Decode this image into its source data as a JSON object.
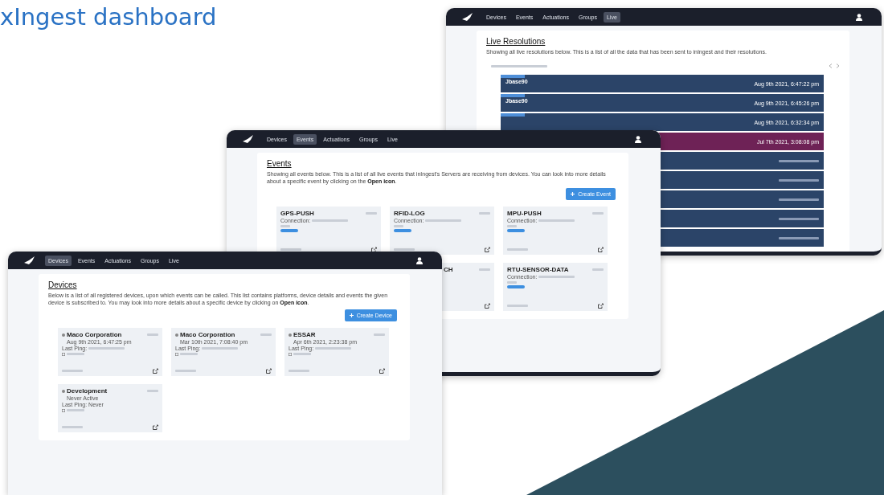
{
  "title": "xIngest dashboard",
  "windows": [
    {
      "kind": "live",
      "nav": [
        {
          "label": "Devices",
          "selected": false
        },
        {
          "label": "Events",
          "selected": false
        },
        {
          "label": "Actuations",
          "selected": false
        },
        {
          "label": "Groups",
          "selected": false
        },
        {
          "label": "Live",
          "selected": true
        }
      ],
      "heading": "Live Resolutions",
      "description": "Showing all live resolutions below. This is a list of all the data that has been sent to inIngest and their resolutions.",
      "rows": [
        {
          "name": "Jbase90",
          "time": "Aug 9th 2021, 6:47:22 pm",
          "color": "#2b4468"
        },
        {
          "name": "Jbase90",
          "time": "Aug 9th 2021, 6:45:26 pm",
          "color": "#2b4468"
        },
        {
          "time": "Aug 9th 2021, 6:32:34 pm",
          "color": "#2b4468"
        },
        {
          "time": "Jul 7th 2021, 3:08:08 pm",
          "color": "#6e2256"
        },
        {
          "color": "#2b4468"
        },
        {
          "color": "#2b4468"
        },
        {
          "color": "#2b4468"
        },
        {
          "color": "#2b4468"
        },
        {
          "color": "#2b4468"
        }
      ]
    },
    {
      "kind": "events",
      "nav": [
        {
          "label": "Devices",
          "selected": false
        },
        {
          "label": "Events",
          "selected": true
        },
        {
          "label": "Actuations",
          "selected": false
        },
        {
          "label": "Groups",
          "selected": false
        },
        {
          "label": "Live",
          "selected": false
        }
      ],
      "heading": "Events",
      "description": "Showing all events below. This is a list of all live events that inIngest's Servers are receiving from devices. You can look into more details about a specific event by clicking on the **Open icon**.",
      "button": "Create Event",
      "cards": [
        {
          "name": "GPS-PUSH",
          "label": "Connection:"
        },
        {
          "name": "RFID-LOG",
          "label": "Connection:"
        },
        {
          "name": "MPU-PUSH",
          "label": "Connection:"
        },
        {
          "name": "CH"
        },
        {
          "name": "RTU-SENSOR-DATA",
          "label": "Connection:"
        }
      ]
    },
    {
      "kind": "devices",
      "nav": [
        {
          "label": "Devices",
          "selected": true
        },
        {
          "label": "Events",
          "selected": false
        },
        {
          "label": "Actuations",
          "selected": false
        },
        {
          "label": "Groups",
          "selected": false
        },
        {
          "label": "Live",
          "selected": false
        }
      ],
      "heading": "Devices",
      "description": "Below is a list of all registered devices, upon which events can be called. This list contains platforms, device details and events the given device is subscribed to. You may look into more details about a specific device by clicking on **Open icon**.",
      "button": "Create Device",
      "cards": [
        {
          "name": "Maco Corporation",
          "date": "Aug 9th 2021, 6:47:25 pm",
          "ping": "Last Ping:"
        },
        {
          "name": "Maco Corporation",
          "date": "Mar 10th 2021, 7:08:40 pm",
          "ping": "Last Ping:"
        },
        {
          "name": "ESSAR",
          "date": "Apr 6th 2021, 2:23:38 pm",
          "ping": "Last Ping:"
        },
        {
          "name": "Development",
          "date": "Never Active",
          "ping": "Last Ping: Never"
        }
      ]
    }
  ]
}
